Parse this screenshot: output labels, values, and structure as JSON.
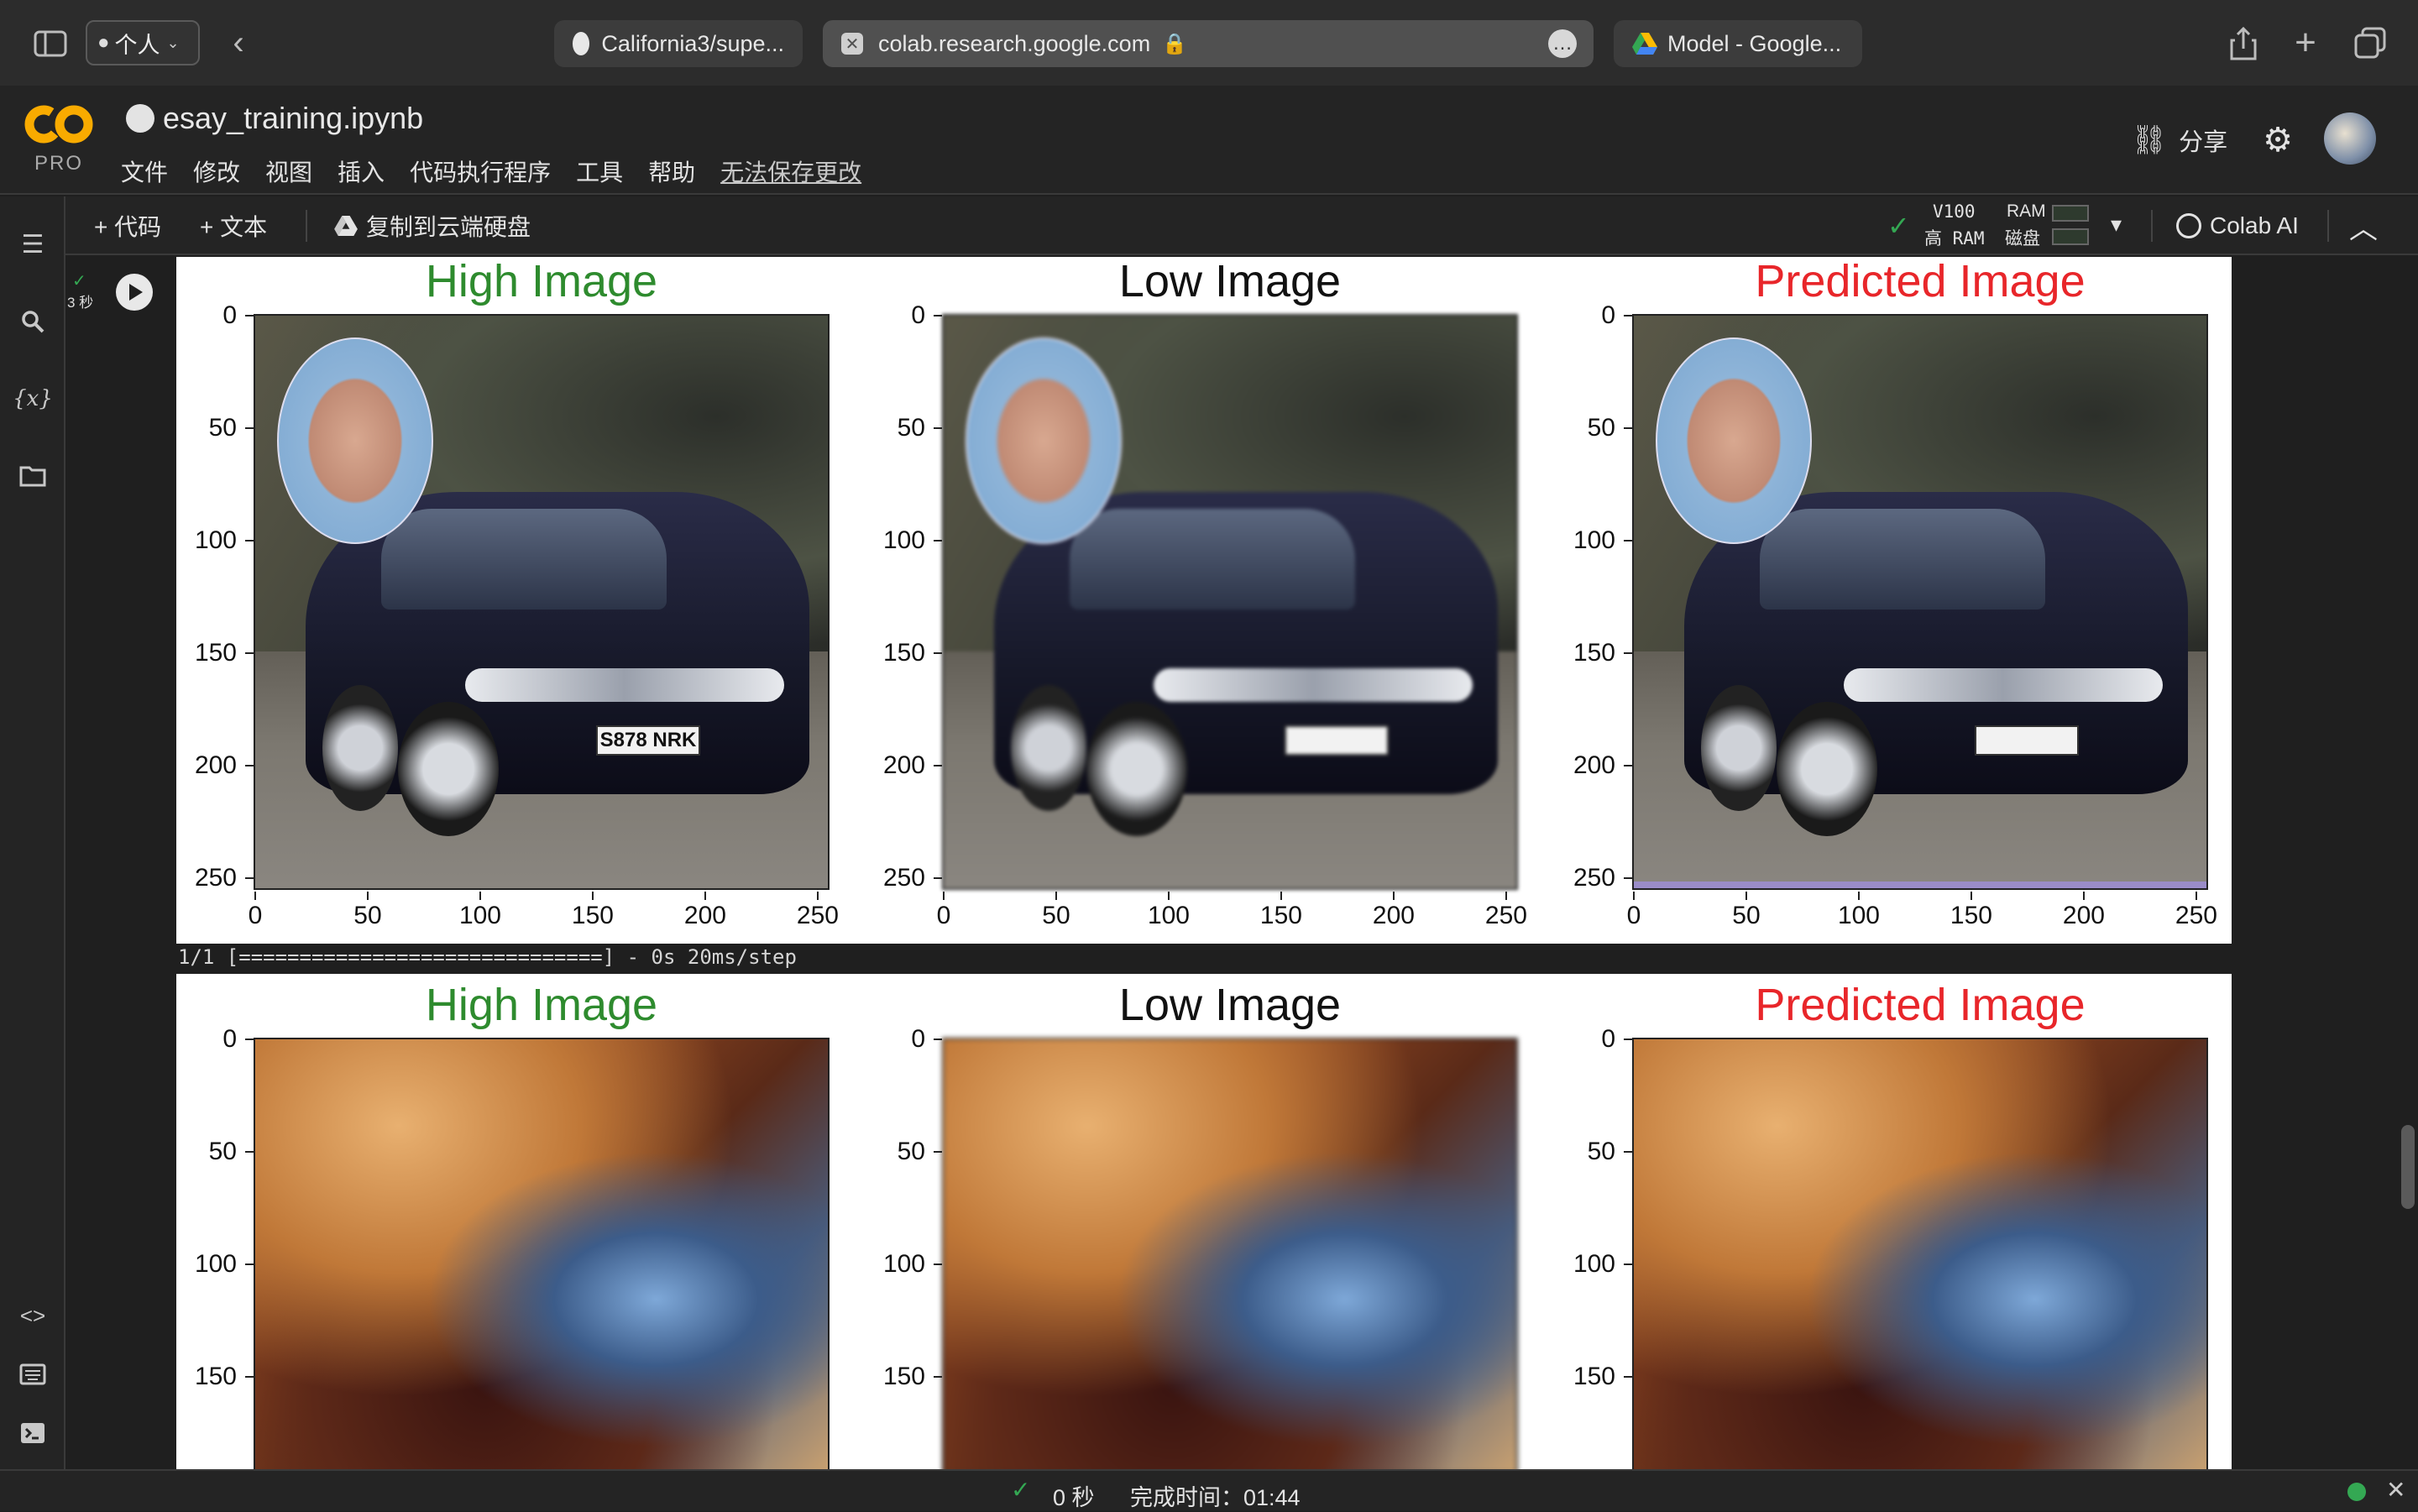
{
  "browser": {
    "profile_label": "个人",
    "tabs": [
      {
        "label": "California3/supe...",
        "icon": "github-icon"
      },
      {
        "label": "colab.research.google.com",
        "icon": "colab-close-icon",
        "active": true
      },
      {
        "label": "Model - Google...",
        "icon": "google-drive-icon"
      }
    ]
  },
  "header": {
    "logo_text": "CO",
    "pro_label": "PRO",
    "notebook_title": "esay_training.ipynb",
    "menu": [
      "文件",
      "修改",
      "视图",
      "插入",
      "代码执行程序",
      "工具",
      "帮助"
    ],
    "unsaved_label": "无法保存更改",
    "share_label": "分享"
  },
  "toolbar": {
    "add_code_label": "+ 代码",
    "add_text_label": "+ 文本",
    "copy_to_drive_label": "复制到云端硬盘",
    "runtime_gpu": "V100",
    "runtime_ram_type": "高 RAM",
    "ram_label": "RAM",
    "disk_label": "磁盘",
    "colab_ai_label": "Colab AI"
  },
  "cell": {
    "exec_time": "3 秒"
  },
  "outputs": {
    "progress_line": "1/1 [==============================] - 0s 20ms/step",
    "figures": [
      {
        "titles": [
          {
            "text": "High Image",
            "color": "#2e8b2e"
          },
          {
            "text": "Low Image",
            "color": "#111111"
          },
          {
            "text": "Predicted Image",
            "color": "#e8262a"
          }
        ],
        "yticks": [
          "0",
          "50",
          "100",
          "150",
          "200",
          "250"
        ],
        "xticks": [
          "0",
          "50",
          "100",
          "150",
          "200",
          "250"
        ],
        "plate_text": "S878 NRK"
      },
      {
        "titles": [
          {
            "text": "High Image",
            "color": "#2e8b2e"
          },
          {
            "text": "Low Image",
            "color": "#111111"
          },
          {
            "text": "Predicted Image",
            "color": "#e8262a"
          }
        ],
        "yticks": [
          "0",
          "50",
          "100",
          "150"
        ]
      }
    ]
  },
  "statusbar": {
    "duration": "0 秒",
    "completed_label": "完成时间：01:44",
    "status_color": "#34a853"
  }
}
